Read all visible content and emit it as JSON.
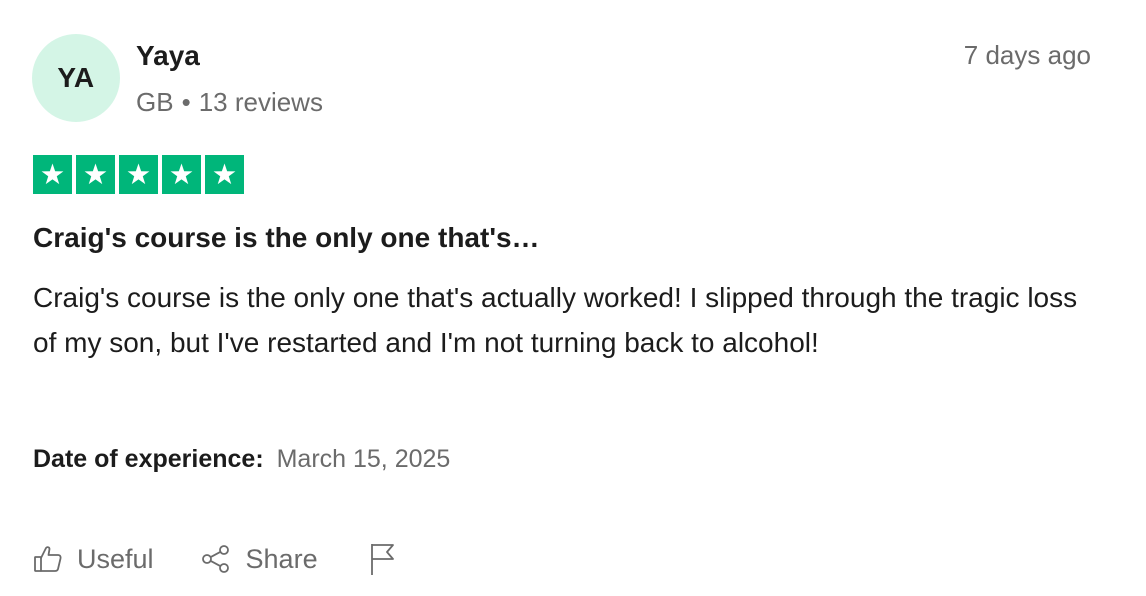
{
  "reviewer": {
    "initials": "YA",
    "name": "Yaya",
    "country": "GB",
    "separator": "•",
    "reviews_count": "13 reviews"
  },
  "posted_time": "7 days ago",
  "rating": {
    "value": 5,
    "max": 5,
    "color": "#00b67a"
  },
  "review": {
    "title": "Craig's course is the only one that's…",
    "body": "Craig's course is the only one that's actually worked! I slipped through the tragic loss of my son, but I've restarted and I'm not turning back to alcohol!"
  },
  "experience": {
    "label": "Date of experience:",
    "date": "March 15, 2025"
  },
  "actions": {
    "useful_label": "Useful",
    "useful_icon": "thumbs-up-icon",
    "share_label": "Share",
    "share_icon": "share-icon",
    "flag_icon": "flag-icon"
  },
  "colors": {
    "avatar_bg": "#d4f5e6",
    "muted_text": "#6b6b6b",
    "primary_text": "#1c1c1c"
  }
}
